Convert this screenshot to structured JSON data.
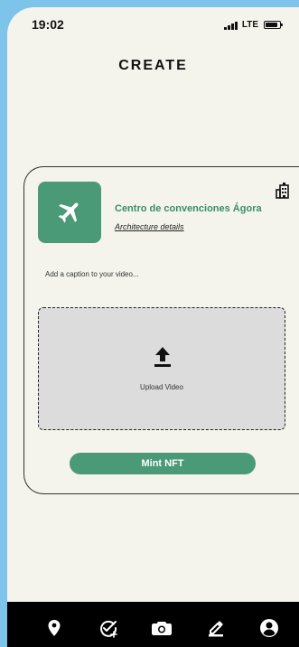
{
  "status_bar": {
    "time": "19:02",
    "network": "LTE",
    "icons": [
      "signal-icon",
      "battery-icon"
    ]
  },
  "header": {
    "title": "CREATE"
  },
  "card": {
    "thumbnail_icon": "airplane-icon",
    "title": "Centro de convenciones Ágora",
    "link": "Architecture details",
    "category_icon": "building-icon",
    "caption_placeholder": "Add a caption to your video...",
    "upload": {
      "icon": "upload-icon",
      "label": "Upload Video"
    },
    "button_label": "Mint NFT"
  },
  "bottom_nav": {
    "items": [
      {
        "icon": "location-pin-icon"
      },
      {
        "icon": "create-check-icon"
      },
      {
        "icon": "camera-icon"
      },
      {
        "icon": "edit-icon"
      },
      {
        "icon": "profile-icon"
      }
    ]
  },
  "colors": {
    "background": "#7ec3ea",
    "surface": "#f4f4ec",
    "accent": "#4a9a78",
    "upload_area": "#dcdcdc",
    "navigation": "#000000"
  }
}
